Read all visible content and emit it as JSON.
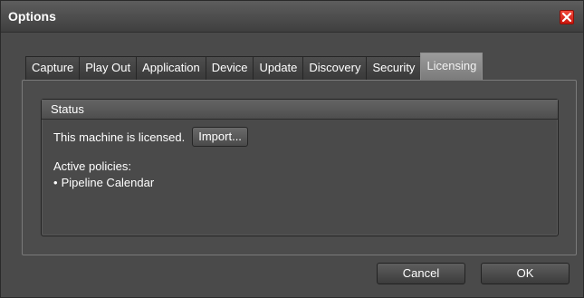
{
  "window": {
    "title": "Options",
    "close_icon": "close-icon"
  },
  "tabs": [
    {
      "label": "Capture",
      "active": false
    },
    {
      "label": "Play Out",
      "active": false
    },
    {
      "label": "Application",
      "active": false
    },
    {
      "label": "Device",
      "active": false
    },
    {
      "label": "Update",
      "active": false
    },
    {
      "label": "Discovery",
      "active": false
    },
    {
      "label": "Security",
      "active": false
    },
    {
      "label": "Licensing",
      "active": true
    }
  ],
  "status_group": {
    "header": "Status",
    "licensed_text": "This machine is licensed.",
    "import_label": "Import...",
    "policies_label": "Active policies:",
    "policy_bullet": "•",
    "policies": [
      "Pipeline Calendar"
    ]
  },
  "footer": {
    "cancel_label": "Cancel",
    "ok_label": "OK"
  },
  "colors": {
    "close_red": "#e0281b",
    "active_tab": "#8a8a8a",
    "window_bg": "#4a4a4a"
  }
}
